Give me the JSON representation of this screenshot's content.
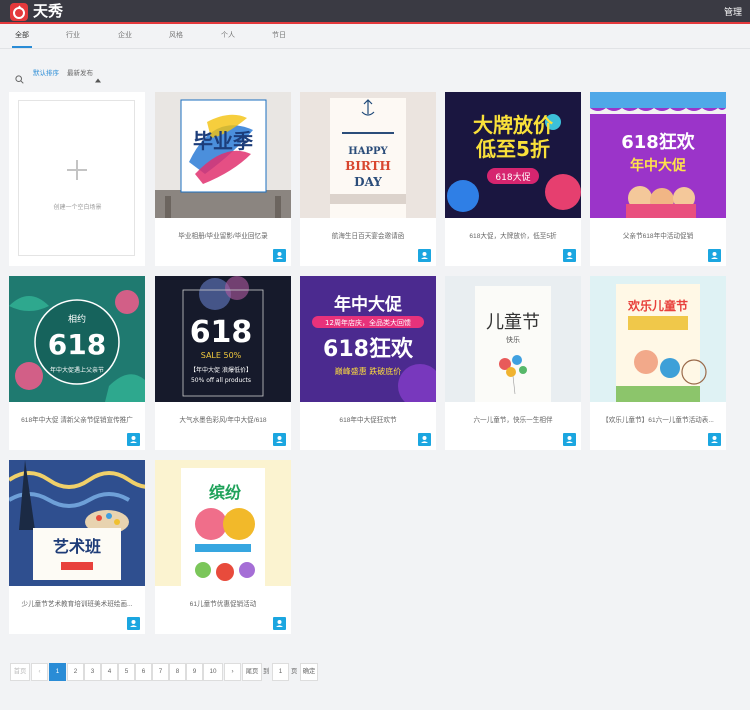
{
  "app": {
    "title": "天秀",
    "admin_label": "管理"
  },
  "tabs": [
    {
      "label": "全部",
      "active": true
    },
    {
      "label": "行业"
    },
    {
      "label": "企业"
    },
    {
      "label": "风格"
    },
    {
      "label": "个人"
    },
    {
      "label": "节日"
    }
  ],
  "sort": {
    "default_label": "默认排序",
    "latest_label": "最新发布"
  },
  "blank_card": {
    "label": "创建一个空白场景"
  },
  "cards": [
    {
      "caption": "毕业相册/毕业留影/毕业回忆录",
      "thumb_text": "毕业季"
    },
    {
      "caption": "航海生日百天宴会邀请函",
      "thumb_text": "HAPPY BIRTH DAY"
    },
    {
      "caption": "618大促，大牌放价，低至5折",
      "thumb_text_1": "大牌放价",
      "thumb_text_2": "低至5折",
      "thumb_text_3": "618大促"
    },
    {
      "caption": "父亲节618年中活动促销",
      "thumb_text_1": "618狂欢",
      "thumb_text_2": "年中大促"
    },
    {
      "caption": "618年中大促 清新父亲节促销宣传推广",
      "thumb_text_1": "相约",
      "thumb_text_2": "618",
      "thumb_text_3": "年中大促遇上父亲节"
    },
    {
      "caption": "大气水墨色彩风/年中大促/618",
      "thumb_text_1": "618",
      "thumb_text_2": "SALE 50%",
      "thumb_text_3": "【年中大促 浪爆低价】",
      "thumb_text_4": "50% off all products"
    },
    {
      "caption": "618年中大促狂欢节",
      "thumb_text_1": "年中大促",
      "thumb_text_2": "12周年店庆，全品类大回馈",
      "thumb_text_3": "618狂欢",
      "thumb_text_4": "巅峰盛惠 跌破底价"
    },
    {
      "caption": "六一儿童节，快乐一生相伴",
      "thumb_text_1": "儿童节",
      "thumb_text_2": "快乐"
    },
    {
      "caption": "【欢乐儿童节】61六一儿童节活动表...",
      "thumb_text_1": "欢乐儿童节"
    },
    {
      "caption": "少儿童节艺术教育培训班美术班绘画...",
      "thumb_text_1": "艺术班"
    },
    {
      "caption": "61儿童节优惠促销活动",
      "thumb_text_1": "缤纷"
    }
  ],
  "pager": {
    "first": "首页",
    "prev": "‹",
    "pages": [
      "1",
      "2",
      "3",
      "4",
      "5",
      "6",
      "7",
      "8",
      "9",
      "10"
    ],
    "next": "›",
    "last": "尾页",
    "goto_prefix": "到",
    "goto_value": "1",
    "goto_suffix": "页",
    "confirm": "确定"
  },
  "colors": {
    "accent": "#2a8cd6",
    "brand": "#e4393c",
    "topbar": "#3a3a43",
    "use_button": "#1ba6e0"
  }
}
